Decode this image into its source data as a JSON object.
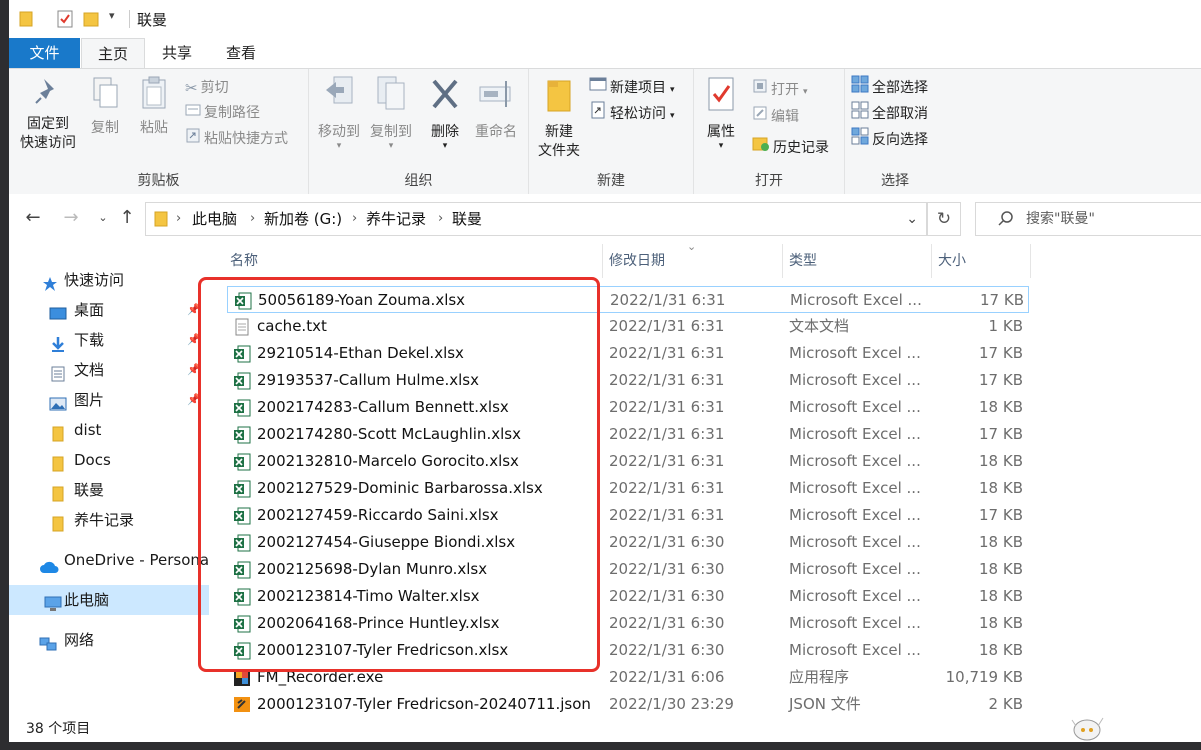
{
  "window": {
    "title": "联曼"
  },
  "ribbon_tabs": [
    "文件",
    "主页",
    "共享",
    "查看"
  ],
  "ribbon": {
    "clipboard": {
      "pin_label": "固定到\n快速访问",
      "copy": "复制",
      "paste": "粘贴",
      "cut": "剪切",
      "copy_path": "复制路径",
      "paste_shortcut": "粘贴快捷方式",
      "group": "剪贴板"
    },
    "organize": {
      "move_to": "移动到",
      "copy_to": "复制到",
      "delete": "删除",
      "rename": "重命名",
      "group": "组织"
    },
    "new": {
      "new_item": "新建项目",
      "easy_access": "轻松访问",
      "new_folder": "新建\n文件夹",
      "group": "新建"
    },
    "open": {
      "properties": "属性",
      "open": "打开",
      "edit": "编辑",
      "history": "历史记录",
      "group": "打开"
    },
    "select": {
      "select_all": "全部选择",
      "select_none": "全部取消",
      "invert": "反向选择",
      "group": "选择"
    }
  },
  "address": {
    "crumbs": [
      "此电脑",
      "新加卷 (G:)",
      "养牛记录",
      "联曼"
    ],
    "search_placeholder": "搜索\"联曼\""
  },
  "nav_pane": {
    "quick_access": "快速访问",
    "items": [
      {
        "label": "桌面",
        "icon": "desktop-icon",
        "pinned": true
      },
      {
        "label": "下载",
        "icon": "download-icon",
        "pinned": true
      },
      {
        "label": "文档",
        "icon": "document-icon",
        "pinned": true
      },
      {
        "label": "图片",
        "icon": "picture-icon",
        "pinned": true
      },
      {
        "label": "dist",
        "icon": "folder-icon",
        "pinned": false
      },
      {
        "label": "Docs",
        "icon": "folder-icon",
        "pinned": false
      },
      {
        "label": "联曼",
        "icon": "folder-icon",
        "pinned": false
      },
      {
        "label": "养牛记录",
        "icon": "folder-icon",
        "pinned": false
      }
    ],
    "onedrive": "OneDrive - Persona",
    "this_pc": "此电脑",
    "network": "网络"
  },
  "columns": {
    "name": "名称",
    "date": "修改日期",
    "type": "类型",
    "size": "大小"
  },
  "files": [
    {
      "name": "50056189-Yoan Zouma.xlsx",
      "date": "2022/1/31 6:31",
      "type": "Microsoft Excel ...",
      "size": "17 KB",
      "icon": "excel-icon",
      "selected": true
    },
    {
      "name": "cache.txt",
      "date": "2022/1/31 6:31",
      "type": "文本文档",
      "size": "1 KB",
      "icon": "text-file-icon"
    },
    {
      "name": "29210514-Ethan Dekel.xlsx",
      "date": "2022/1/31 6:31",
      "type": "Microsoft Excel ...",
      "size": "17 KB",
      "icon": "excel-icon"
    },
    {
      "name": "29193537-Callum Hulme.xlsx",
      "date": "2022/1/31 6:31",
      "type": "Microsoft Excel ...",
      "size": "17 KB",
      "icon": "excel-icon"
    },
    {
      "name": "2002174283-Callum Bennett.xlsx",
      "date": "2022/1/31 6:31",
      "type": "Microsoft Excel ...",
      "size": "18 KB",
      "icon": "excel-icon"
    },
    {
      "name": "2002174280-Scott McLaughlin.xlsx",
      "date": "2022/1/31 6:31",
      "type": "Microsoft Excel ...",
      "size": "17 KB",
      "icon": "excel-icon"
    },
    {
      "name": "2002132810-Marcelo Gorocito.xlsx",
      "date": "2022/1/31 6:31",
      "type": "Microsoft Excel ...",
      "size": "18 KB",
      "icon": "excel-icon"
    },
    {
      "name": "2002127529-Dominic Barbarossa.xlsx",
      "date": "2022/1/31 6:31",
      "type": "Microsoft Excel ...",
      "size": "18 KB",
      "icon": "excel-icon"
    },
    {
      "name": "2002127459-Riccardo Saini.xlsx",
      "date": "2022/1/31 6:31",
      "type": "Microsoft Excel ...",
      "size": "17 KB",
      "icon": "excel-icon"
    },
    {
      "name": "2002127454-Giuseppe Biondi.xlsx",
      "date": "2022/1/31 6:30",
      "type": "Microsoft Excel ...",
      "size": "18 KB",
      "icon": "excel-icon"
    },
    {
      "name": "2002125698-Dylan Munro.xlsx",
      "date": "2022/1/31 6:30",
      "type": "Microsoft Excel ...",
      "size": "18 KB",
      "icon": "excel-icon"
    },
    {
      "name": "2002123814-Timo Walter.xlsx",
      "date": "2022/1/31 6:30",
      "type": "Microsoft Excel ...",
      "size": "18 KB",
      "icon": "excel-icon"
    },
    {
      "name": "2002064168-Prince Huntley.xlsx",
      "date": "2022/1/31 6:30",
      "type": "Microsoft Excel ...",
      "size": "18 KB",
      "icon": "excel-icon"
    },
    {
      "name": "2000123107-Tyler Fredricson.xlsx",
      "date": "2022/1/31 6:30",
      "type": "Microsoft Excel ...",
      "size": "18 KB",
      "icon": "excel-icon"
    },
    {
      "name": "FM_Recorder.exe",
      "date": "2022/1/31 6:06",
      "type": "应用程序",
      "size": "10,719 KB",
      "icon": "exe-icon"
    },
    {
      "name": "2000123107-Tyler Fredricson-20240711.json",
      "date": "2022/1/30 23:29",
      "type": "JSON 文件",
      "size": "2 KB",
      "icon": "json-file-icon"
    }
  ],
  "status": {
    "count": "38 个项目"
  },
  "colors": {
    "file_tab": "#1979ca",
    "selection": "#cce8ff",
    "annotation": "#e8312a",
    "excel": "#1e7145"
  }
}
